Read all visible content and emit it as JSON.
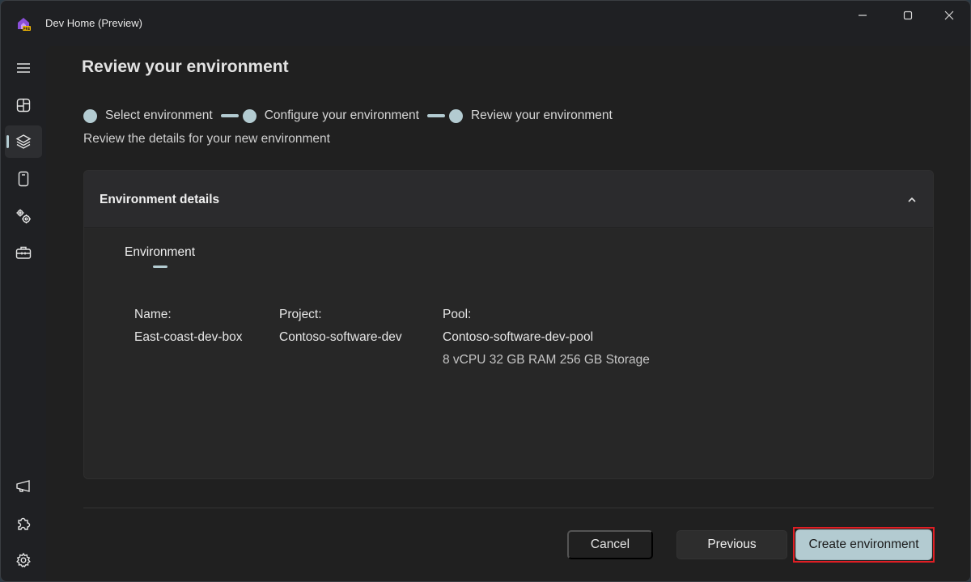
{
  "window": {
    "title": "Dev Home (Preview)",
    "app_icon": "dev-home-icon",
    "controls": {
      "minimize": "minimize-icon",
      "maximize": "maximize-icon",
      "close": "close-icon"
    }
  },
  "navrail": {
    "top_items": [
      {
        "name": "menu",
        "icon": "hamburger-icon"
      },
      {
        "name": "dashboard",
        "icon": "dashboard-icon"
      },
      {
        "name": "environments",
        "icon": "layers-icon",
        "selected": true
      },
      {
        "name": "device",
        "icon": "device-icon"
      },
      {
        "name": "machine-configuration",
        "icon": "gears-icon"
      },
      {
        "name": "utilities",
        "icon": "toolbox-icon"
      }
    ],
    "bottom_items": [
      {
        "name": "whats-new",
        "icon": "megaphone-icon"
      },
      {
        "name": "extensions",
        "icon": "puzzle-icon"
      },
      {
        "name": "settings",
        "icon": "gear-icon"
      }
    ]
  },
  "page": {
    "title": "Review your environment",
    "steps": [
      {
        "label": "Select environment"
      },
      {
        "label": "Configure your environment"
      },
      {
        "label": "Review your environment"
      }
    ],
    "subtitle": "Review the details for your new environment"
  },
  "card": {
    "title": "Environment details",
    "expanded": true,
    "tab": "Environment",
    "fields": {
      "name": {
        "label": "Name:",
        "value": "East-coast-dev-box"
      },
      "project": {
        "label": "Project:",
        "value": "Contoso-software-dev"
      },
      "pool": {
        "label": "Pool:",
        "value": "Contoso-software-dev-pool",
        "specs": "8 vCPU 32 GB RAM 256 GB Storage"
      }
    }
  },
  "footer": {
    "cancel_label": "Cancel",
    "previous_label": "Previous",
    "create_label": "Create environment"
  },
  "colors": {
    "accent": "#b3cbd1",
    "highlight_outline": "#e01e24",
    "background": "#202020",
    "card": "#2b2b2b"
  }
}
